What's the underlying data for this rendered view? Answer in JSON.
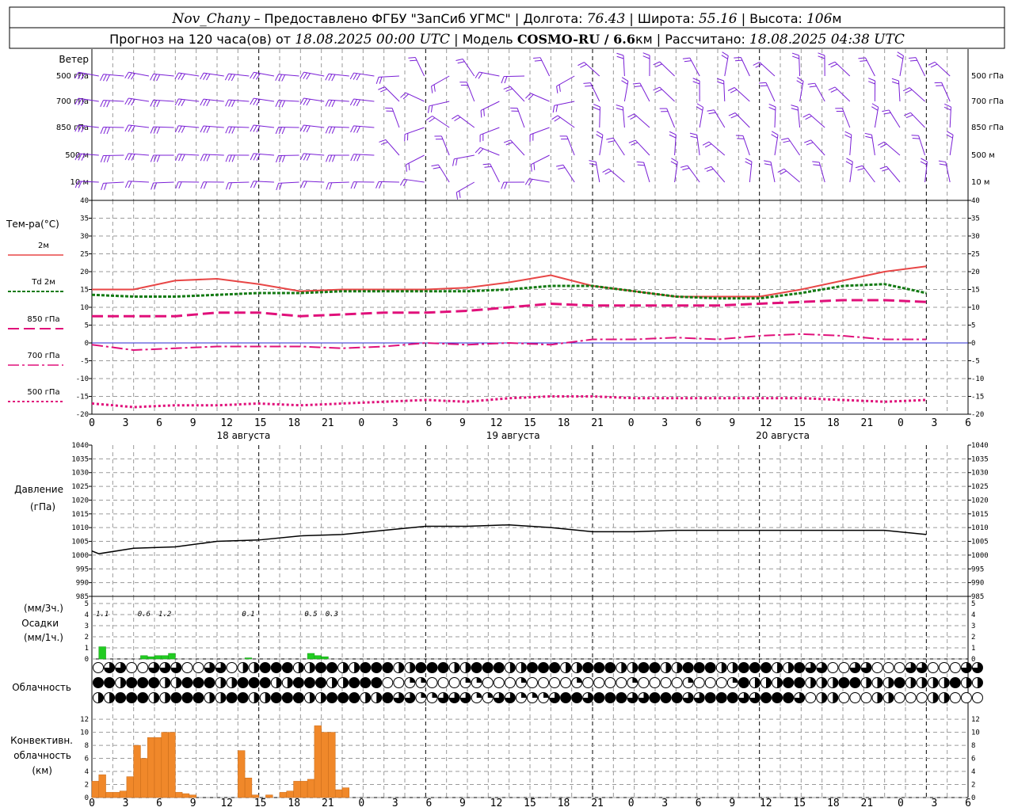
{
  "header": {
    "station": "Nov_Chany",
    "provider": " – Предоставлено ФГБУ \"ЗапСиб УГМС\" | Долгота: ",
    "lon": "76.43",
    "lat_label": " | Широта: ",
    "lat": "55.16",
    "alt_label": " | Высота: ",
    "alt": "106",
    "alt_unit": "м",
    "forecast_label": "Прогноз на 120 часа(ов) от ",
    "start_time": "18.08.2025 00:00 UTC",
    "model_label": " | Модель ",
    "model": "COSMO-RU / 6.6",
    "model_unit": "км",
    "calc_label": " | Рассчитано: ",
    "calc_time": "18.08.2025 04:38 UTC"
  },
  "wind_panel": {
    "title": "Ветер",
    "levels": [
      "500 гПа",
      "700 гПа",
      "850 гПа",
      "500 м",
      "10  м"
    ]
  },
  "temp_panel": {
    "title": "Тем-ра(°С)",
    "legend": [
      {
        "label": "2м",
        "color": "#e84646"
      },
      {
        "label": "Td  2м",
        "color": "#137a13"
      },
      {
        "label": "850 гПа",
        "color": "#e0107a"
      },
      {
        "label": "700 гПа",
        "color": "#e0107a"
      },
      {
        "label": "500 гПа",
        "color": "#e0107a"
      }
    ]
  },
  "x_axis": {
    "tick_labels": [
      "0",
      "3",
      "6",
      "9",
      "12",
      "15",
      "18",
      "21",
      "0",
      "3",
      "6",
      "9",
      "12",
      "15",
      "18",
      "21",
      "0",
      "3",
      "6",
      "9",
      "12",
      "15",
      "18",
      "21",
      "0",
      "3",
      "6"
    ],
    "dates": [
      "18 августа",
      "19 августа",
      "20 августа"
    ]
  },
  "pressure_panel": {
    "title": "Давление",
    "unit": "(гПа)"
  },
  "precip_panel": {
    "unit_3h": "(мм/3ч.)",
    "title": "Осадки",
    "unit_1h": "(мм/1ч.)",
    "labels_3h": [
      {
        "hour": 1.5,
        "text": "1.1"
      },
      {
        "hour": 7.5,
        "text": "0.6"
      },
      {
        "hour": 10.5,
        "text": "1.2"
      },
      {
        "hour": 22.5,
        "text": "0.1"
      },
      {
        "hour": 31.5,
        "text": "0.5"
      },
      {
        "hour": 34.5,
        "text": "0.3"
      }
    ]
  },
  "cloud_panel": {
    "title": "Облачность"
  },
  "conv_panel": {
    "title1": "Конвективн.",
    "title2": "облачность",
    "title3": "(км)"
  },
  "colors": {
    "wind": "#7a1fd6",
    "t2m": "#e84646",
    "td2m": "#137a13",
    "upper": "#e0107a",
    "precip": "#22cc22",
    "conv": "#f0882a",
    "pressure": "#000000"
  },
  "chart_data": [
    {
      "type": "line",
      "title": "Тем-ра(°С)",
      "ylim": [
        -20,
        40
      ],
      "x_hours": [
        0,
        6,
        12,
        18,
        24,
        30,
        36,
        42,
        48,
        54,
        60,
        66,
        72,
        78,
        84,
        90,
        96,
        102,
        108,
        114,
        120
      ],
      "series": [
        {
          "name": "2м",
          "values": [
            15,
            15,
            17.5,
            18,
            16.5,
            14.5,
            15,
            15,
            15,
            15.5,
            17,
            19,
            16,
            14.5,
            13,
            13,
            13,
            15,
            17.5,
            20,
            21.5
          ]
        },
        {
          "name": "Td  2м",
          "values": [
            13.5,
            13,
            13,
            13.5,
            14,
            14,
            14.5,
            14.5,
            14.5,
            14.5,
            15,
            16,
            16,
            14.5,
            13,
            12.5,
            12.5,
            14,
            16,
            16.5,
            14
          ]
        },
        {
          "name": "850 гПа",
          "values": [
            7.5,
            7.5,
            7.5,
            8.5,
            8.5,
            7.5,
            8,
            8.5,
            8.5,
            9,
            10,
            11,
            10.5,
            10.5,
            10.5,
            10.5,
            11,
            11.5,
            12,
            12,
            11.5
          ]
        },
        {
          "name": "700 гПа",
          "values": [
            -0.5,
            -2,
            -1.5,
            -1,
            -1,
            -1,
            -1.5,
            -1,
            0,
            -0.5,
            0,
            -0.5,
            1,
            1,
            1.5,
            1,
            2,
            2.5,
            2,
            1,
            1
          ]
        },
        {
          "name": "500 гПа",
          "values": [
            -17,
            -18,
            -17.5,
            -17.5,
            -17,
            -17.5,
            -17,
            -16.5,
            -16,
            -16.5,
            -15.5,
            -15,
            -15,
            -15.5,
            -15.5,
            -15.5,
            -15.5,
            -15.5,
            -16,
            -16.5,
            -16
          ]
        }
      ]
    },
    {
      "type": "line",
      "title": "Давление",
      "ylim": [
        985,
        1040
      ],
      "x_hours": [
        0,
        1,
        6,
        12,
        18,
        24,
        30,
        36,
        42,
        48,
        54,
        60,
        66,
        72,
        78,
        84,
        90,
        96,
        102,
        108,
        114,
        120
      ],
      "series": [
        {
          "name": "Давление",
          "values": [
            1001.5,
            1000.5,
            1002.5,
            1003,
            1005,
            1005.5,
            1007,
            1007.5,
            1009,
            1010.5,
            1010.5,
            1011,
            1010,
            1008.5,
            1008.5,
            1009,
            1009,
            1009,
            1009,
            1009,
            1009,
            1007.5
          ]
        }
      ]
    },
    {
      "type": "bar",
      "title": "Осадки",
      "ylim": [
        0,
        5
      ],
      "x_hours": [
        1.5,
        7.5,
        8.5,
        9.5,
        10.5,
        11.5,
        22.5,
        31.5,
        32.5,
        33.5
      ],
      "values": [
        1.1,
        0.3,
        0.2,
        0.3,
        0.3,
        0.5,
        0.1,
        0.5,
        0.3,
        0.2
      ]
    },
    {
      "type": "bar",
      "title": "Конвективн. облачность",
      "ylim": [
        0,
        12
      ],
      "x_hours": [
        0.5,
        1.5,
        2.5,
        3.5,
        4.5,
        5.5,
        6.5,
        7.5,
        8.5,
        9.5,
        10.5,
        11.5,
        12.5,
        13.5,
        14.5,
        21.5,
        22.5,
        23.5,
        25.5,
        27.5,
        28.5,
        29.5,
        30.5,
        31.5,
        32.5,
        33.5,
        34.5,
        35.5,
        36.5
      ],
      "values": [
        2.5,
        3.5,
        0.8,
        0.8,
        1,
        3.2,
        8,
        6,
        9.2,
        9.2,
        10,
        10,
        0.8,
        0.6,
        0.4,
        7.2,
        3,
        0.4,
        0.4,
        0.8,
        1,
        2.5,
        2.5,
        2.8,
        11,
        10,
        10,
        1.2,
        1.5
      ]
    }
  ]
}
